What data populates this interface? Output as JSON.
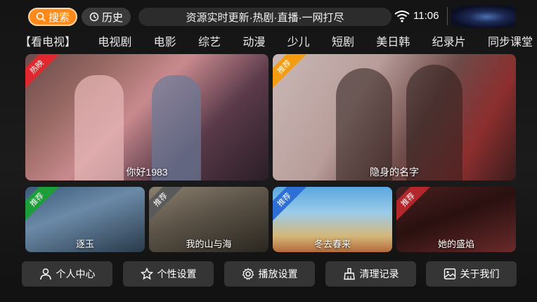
{
  "topbar": {
    "search_label": "搜索",
    "history_label": "历史",
    "marquee_text": "资源实时更新·热剧·直播·一网打尽",
    "time": "11:06"
  },
  "nav": {
    "items": [
      "【看电视】",
      "电视剧",
      "电影",
      "综艺",
      "动漫",
      "少儿",
      "短剧",
      "美日韩",
      "纪录片",
      "同步课堂"
    ]
  },
  "featured": [
    {
      "title": "你好1983",
      "badge": "热映",
      "badge_color": "#e0282e"
    },
    {
      "title": "隐身的名字",
      "badge": "推荐",
      "badge_color": "#f39c12"
    }
  ],
  "recommended": [
    {
      "title": "逐玉",
      "badge": "推荐",
      "badge_color": "#1e9e3a"
    },
    {
      "title": "我的山与海",
      "badge": "推荐",
      "badge_color": "#5a5a5a"
    },
    {
      "title": "冬去春来",
      "badge": "推荐",
      "badge_color": "#2e6fd6"
    },
    {
      "title": "她的盛焰",
      "badge": "推荐",
      "badge_color": "#b3262c"
    }
  ],
  "bottom_buttons": [
    {
      "label": "个人中心",
      "icon": "user-icon"
    },
    {
      "label": "个性设置",
      "icon": "star-icon"
    },
    {
      "label": "播放设置",
      "icon": "gear-icon"
    },
    {
      "label": "清理记录",
      "icon": "broom-icon"
    },
    {
      "label": "关于我们",
      "icon": "image-icon"
    }
  ],
  "colors": {
    "accent": "#ff8a1a",
    "button_bg": "#353535"
  }
}
